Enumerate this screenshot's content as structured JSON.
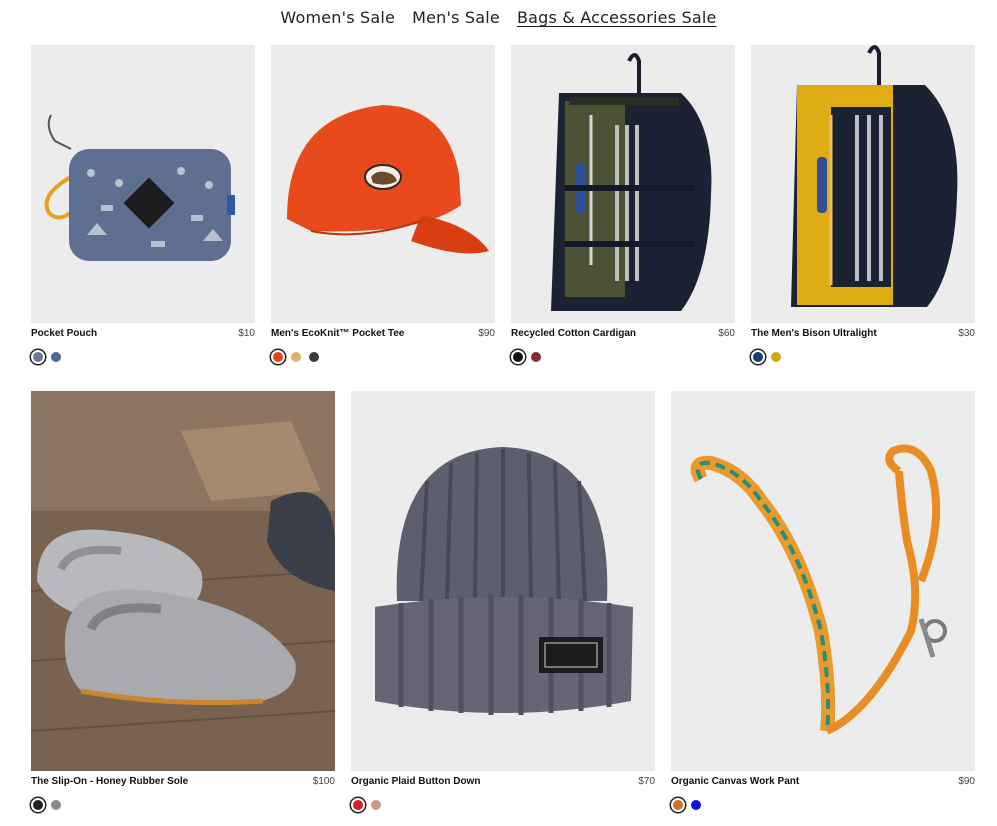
{
  "nav": {
    "tabs": [
      {
        "label": "Women's Sale",
        "active": false
      },
      {
        "label": "Men's Sale",
        "active": false
      },
      {
        "label": "Bags & Accessories Sale",
        "active": true
      }
    ]
  },
  "products": [
    {
      "name": "Pocket Pouch",
      "price": "$10",
      "image_icon": "pouch-icon",
      "swatches": [
        "#6b7795",
        "#4a6a9a"
      ]
    },
    {
      "name": "Men's EcoKnit™ Pocket Tee",
      "price": "$90",
      "image_icon": "cap-icon",
      "swatches": [
        "#e8431f",
        "#e0b070",
        "#3b3b3b"
      ]
    },
    {
      "name": "Recycled Cotton Cardigan",
      "price": "$60",
      "image_icon": "straw-kit-olive-icon",
      "swatches": [
        "#111111",
        "#8a2c35"
      ]
    },
    {
      "name": "The Men's Bison Ultralight",
      "price": "$30",
      "image_icon": "straw-kit-yellow-icon",
      "swatches": [
        "#163d78",
        "#d8a50e"
      ]
    },
    {
      "name": "The Slip-On - Honey Rubber Sole",
      "price": "$100",
      "image_icon": "felt-slippers-icon",
      "swatches": [
        "#222222",
        "#8a8a8a"
      ]
    },
    {
      "name": "Organic Plaid Button Down",
      "price": "$70",
      "image_icon": "beanie-icon",
      "swatches": [
        "#d81c2a",
        "#c89a82"
      ]
    },
    {
      "name": "Organic Canvas Work Pant",
      "price": "$90",
      "image_icon": "leash-icon",
      "swatches": [
        "#c8702c",
        "#1010e8"
      ]
    }
  ]
}
